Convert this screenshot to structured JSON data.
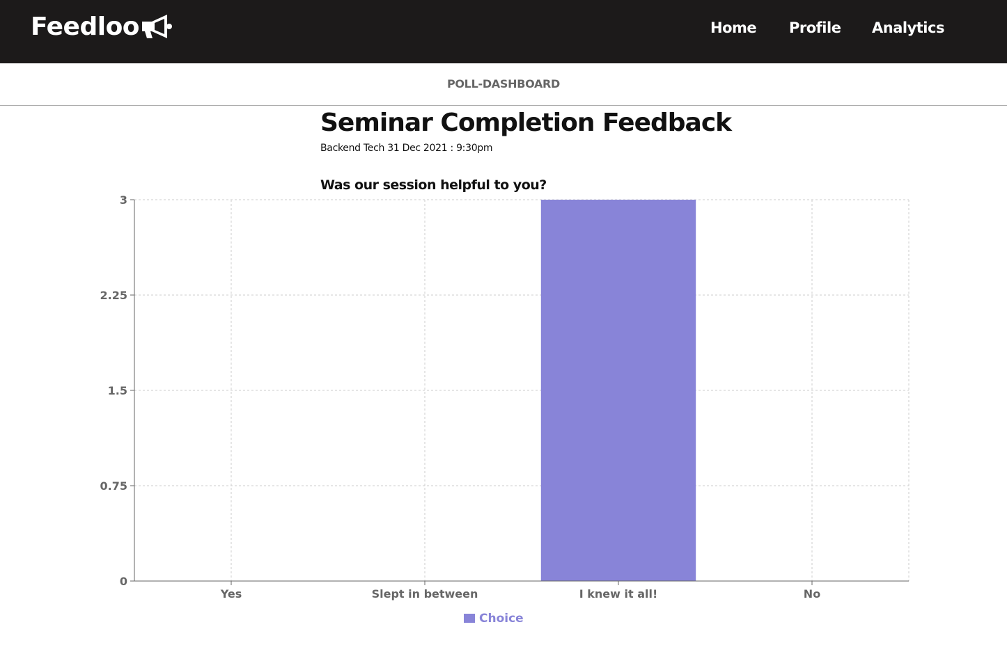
{
  "nav": {
    "brand": "Feedloo",
    "brand_icon": "megaphone-icon",
    "links": [
      {
        "label": "Home"
      },
      {
        "label": "Profile"
      },
      {
        "label": "Analytics"
      }
    ]
  },
  "subheader": "POLL-DASHBOARD",
  "poll": {
    "title": "Seminar Completion Feedback",
    "meta": "Backend Tech 31 Dec 2021 : 9:30pm",
    "question": "Was our session helpful to you?"
  },
  "chart_data": {
    "type": "bar",
    "categories": [
      "Yes",
      "Slept in between",
      "I knew it all!",
      "No"
    ],
    "series": [
      {
        "name": "Choice",
        "values": [
          0,
          0,
          3,
          0
        ],
        "color": "#8884d8"
      }
    ],
    "yticks": [
      "0",
      "0.75",
      "1.5",
      "2.25",
      "3"
    ],
    "ylim": [
      0,
      3
    ],
    "grid": true,
    "legend": "bottom"
  }
}
